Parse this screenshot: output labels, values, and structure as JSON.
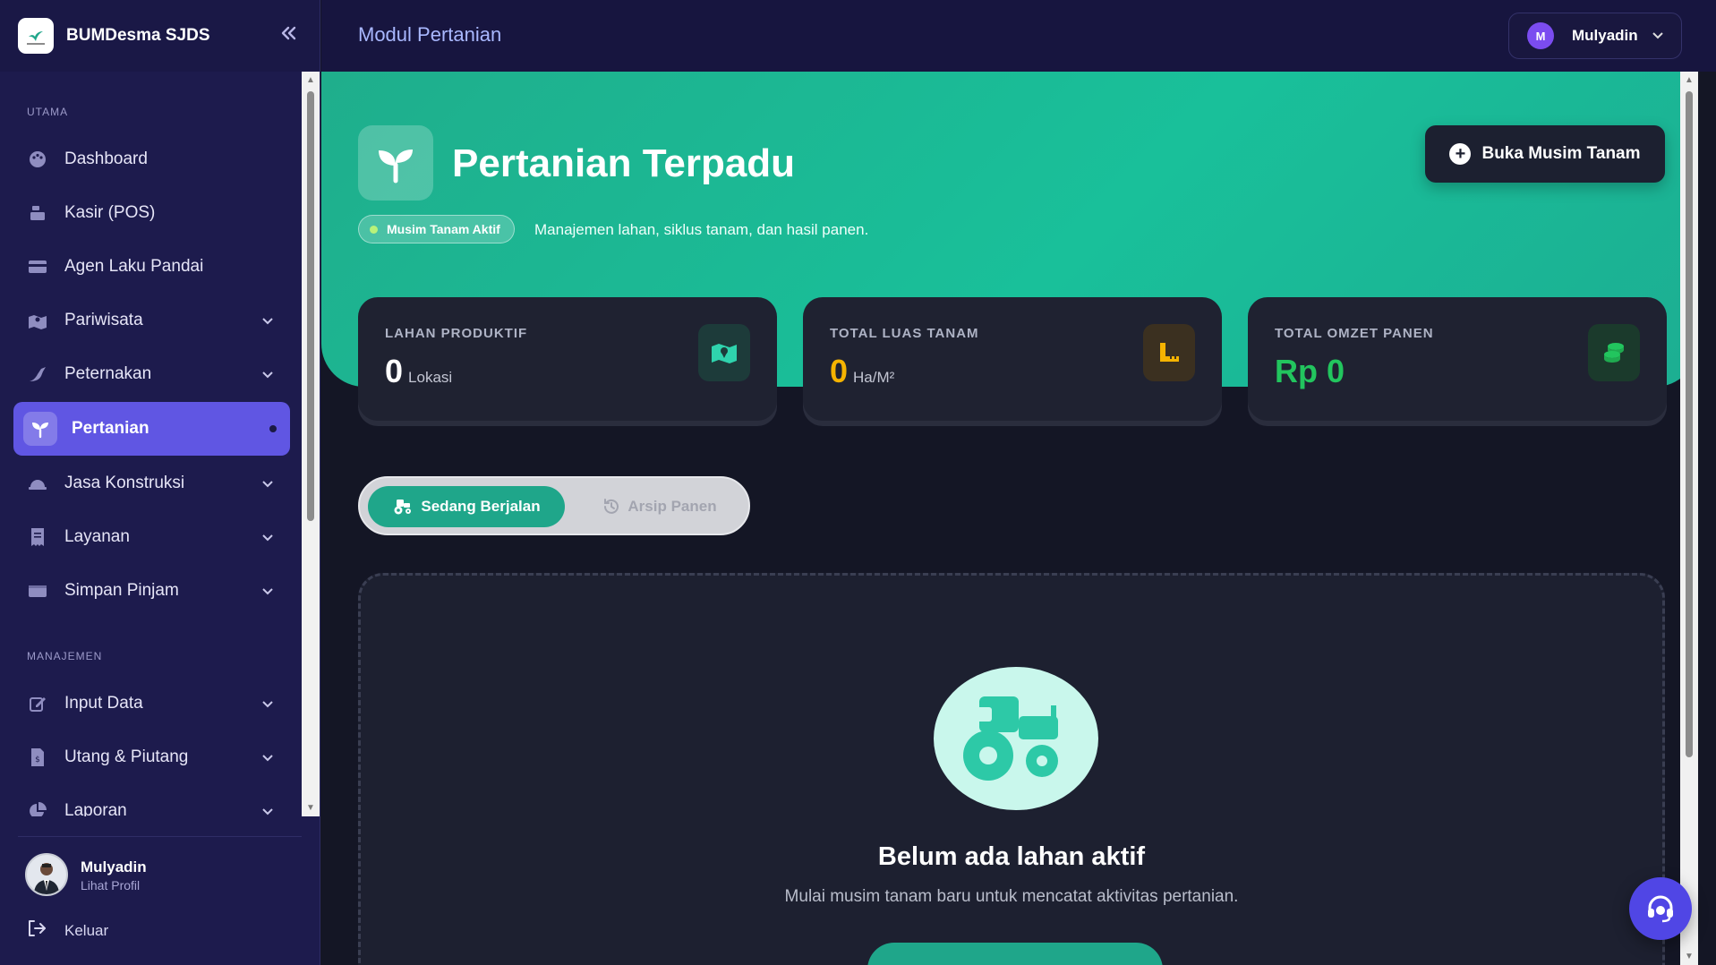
{
  "brand": {
    "name": "BUMDesma SJDS",
    "collapse_icon": "double-chevron-left-icon"
  },
  "sidebar": {
    "sections": [
      {
        "label": "UTAMA"
      },
      {
        "label": "MANAJEMEN"
      }
    ],
    "items": [
      {
        "label": "Dashboard",
        "icon": "palette-icon",
        "has_chevron": false
      },
      {
        "label": "Kasir (POS)",
        "icon": "cash-register-icon",
        "has_chevron": false
      },
      {
        "label": "Agen Laku Pandai",
        "icon": "credit-card-icon",
        "has_chevron": false
      },
      {
        "label": "Pariwisata",
        "icon": "map-pin-icon",
        "has_chevron": true
      },
      {
        "label": "Peternakan",
        "icon": "bird-icon",
        "has_chevron": true
      },
      {
        "label": "Pertanian",
        "icon": "seedling-icon",
        "active": true
      },
      {
        "label": "Jasa Konstruksi",
        "icon": "hard-hat-icon",
        "has_chevron": true
      },
      {
        "label": "Layanan",
        "icon": "receipt-icon",
        "has_chevron": true
      },
      {
        "label": "Simpan Pinjam",
        "icon": "wallet-icon",
        "has_chevron": true
      },
      {
        "label": "Input Data",
        "icon": "edit-icon",
        "has_chevron": true
      },
      {
        "label": "Utang & Piutang",
        "icon": "invoice-icon",
        "has_chevron": true
      },
      {
        "label": "Laporan",
        "icon": "pie-chart-icon",
        "has_chevron": true
      }
    ],
    "profile": {
      "name": "Mulyadin",
      "sub": "Lihat Profil"
    },
    "logout": "Keluar"
  },
  "topbar": {
    "title": "Modul Pertanian",
    "user": {
      "initial": "M",
      "name": "Mulyadin"
    }
  },
  "hero": {
    "title": "Pertanian Terpadu",
    "badge": "Musim Tanam Aktif",
    "description": "Manajemen lahan, siklus tanam, dan hasil panen.",
    "cta": "Buka Musim Tanam"
  },
  "stats": [
    {
      "label": "LAHAN PRODUKTIF",
      "value": "0",
      "unit": "Lokasi",
      "icon": "map-icon",
      "value_color": "#ffffff",
      "icon_bg": "#1d3b3a",
      "icon_color": "#2fd3ad"
    },
    {
      "label": "TOTAL LUAS TANAM",
      "value": "0",
      "unit": "Ha/M²",
      "icon": "ruler-icon",
      "value_color": "#f5b301",
      "icon_bg": "#3b3020",
      "icon_color": "#f5b301"
    },
    {
      "label": "TOTAL OMZET PANEN",
      "value": "Rp 0",
      "unit": "",
      "icon": "coins-icon",
      "value_color": "#22c55e",
      "icon_bg": "#1b3a2c",
      "icon_color": "#22c55e"
    }
  ],
  "tabs": {
    "active": {
      "label": "Sedang Berjalan",
      "icon": "tractor-icon"
    },
    "inactive": {
      "label": "Arsip Panen",
      "icon": "history-icon"
    }
  },
  "empty_state": {
    "title": "Belum ada lahan aktif",
    "description": "Mulai musim tanam baru untuk mencatat aktivitas pertanian.",
    "icon": "tractor-icon"
  },
  "help_icon": "headset-icon",
  "colors": {
    "accent": "#6056e3",
    "teal": "#1fa68a",
    "sidebar": "#1d1b4d"
  }
}
